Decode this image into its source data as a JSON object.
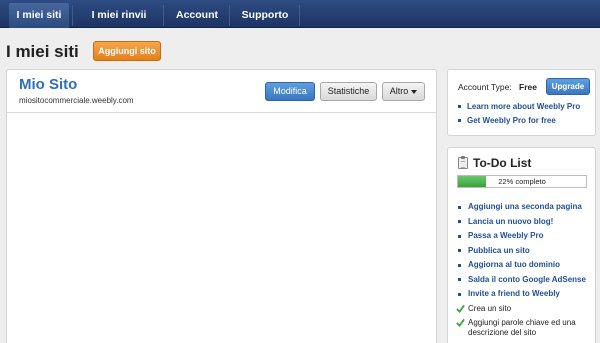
{
  "nav": {
    "tabs": [
      {
        "label": "I miei siti"
      },
      {
        "label": "I miei rinvii"
      },
      {
        "label": "Account"
      },
      {
        "label": "Supporto"
      }
    ]
  },
  "header": {
    "title": "I miei siti",
    "add_button": "Aggiungi sito"
  },
  "site": {
    "name": "Mio Sito",
    "url": "miositocommerciale.weebly.com",
    "edit_label": "Modifica",
    "stats_label": "Statistiche",
    "more_label": "Altro"
  },
  "account": {
    "type_label": "Account Type:",
    "type_value": "Free",
    "upgrade_label": "Upgrade",
    "links": [
      "Learn more about Weebly Pro",
      "Get Weebly Pro for free"
    ]
  },
  "todo": {
    "title": "To-Do List",
    "progress_percent": 22,
    "progress_text": "22% completo",
    "items": [
      {
        "label": "Aggiungi una seconda pagina",
        "done": false
      },
      {
        "label": "Lancia un nuovo blog!",
        "done": false
      },
      {
        "label": "Passa a Weebly Pro",
        "done": false
      },
      {
        "label": "Pubblica un sito",
        "done": false
      },
      {
        "label": "Aggiorna al tuo dominio",
        "done": false
      },
      {
        "label": "Salda il conto Google AdSense",
        "done": false
      },
      {
        "label": "Invite a friend to Weebly",
        "done": false
      },
      {
        "label": "Crea un sito",
        "done": true
      },
      {
        "label": "Aggiungi parole chiave ed una descrizione del sito",
        "done": true
      }
    ]
  },
  "colors": {
    "nav_bg": "#1d3464",
    "link": "#1f4f98",
    "accent_orange": "#e3801b",
    "accent_blue": "#3a77c0",
    "progress_green": "#3aa33c"
  }
}
